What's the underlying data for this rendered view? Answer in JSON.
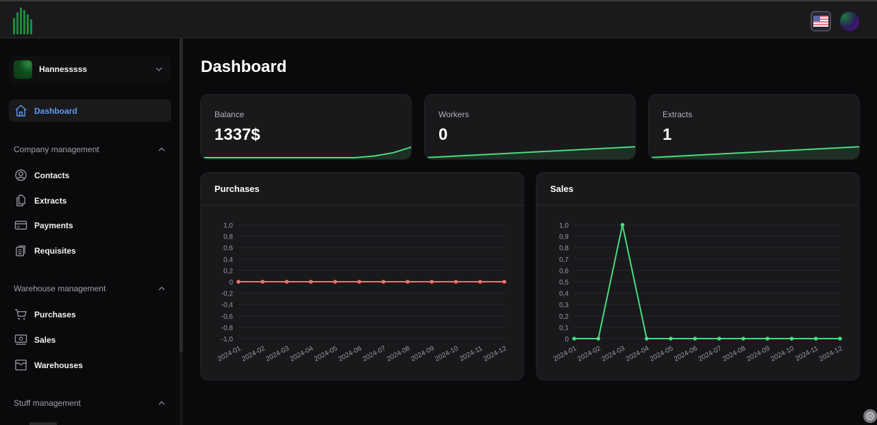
{
  "topbar": {
    "logo_icon": "bar-chart-logo",
    "language_icon": "us-flag-icon",
    "language": "English (US)",
    "user_avatar_icon": "user-avatar"
  },
  "sidebar": {
    "user": {
      "name": "Hannesssss"
    },
    "active_item": {
      "label": "Dashboard",
      "icon": "home-icon"
    },
    "sections": [
      {
        "title": "Company management",
        "expanded": true,
        "items": [
          {
            "label": "Contacts",
            "icon": "user-circle-icon"
          },
          {
            "label": "Extracts",
            "icon": "documents-icon"
          },
          {
            "label": "Payments",
            "icon": "credit-card-icon"
          },
          {
            "label": "Requisites",
            "icon": "clipboard-icon"
          }
        ]
      },
      {
        "title": "Warehouse management",
        "expanded": true,
        "items": [
          {
            "label": "Purchases",
            "icon": "cart-icon"
          },
          {
            "label": "Sales",
            "icon": "cash-icon"
          },
          {
            "label": "Warehouses",
            "icon": "archive-box-icon"
          }
        ]
      },
      {
        "title": "Stuff management",
        "expanded": true,
        "items": []
      }
    ]
  },
  "main": {
    "title": "Dashboard",
    "stats": [
      {
        "label": "Balance",
        "value": "1337$",
        "trend": [
          0,
          0,
          0,
          0,
          0,
          0,
          0,
          0,
          0,
          0.15,
          0.45,
          1
        ]
      },
      {
        "label": "Workers",
        "value": "0",
        "trend": [
          0,
          1
        ]
      },
      {
        "label": "Extracts",
        "value": "1",
        "trend": [
          0,
          1
        ]
      }
    ],
    "accent_green": "#4ade80",
    "accent_red": "#f87171"
  },
  "chart_data": [
    {
      "type": "line",
      "title": "Purchases",
      "categories": [
        "2024-01",
        "2024-02",
        "2024-03",
        "2024-04",
        "2024-05",
        "2024-06",
        "2024-07",
        "2024-08",
        "2024-09",
        "2024-10",
        "2024-11",
        "2024-12"
      ],
      "values": [
        0,
        0,
        0,
        0,
        0,
        0,
        0,
        0,
        0,
        0,
        0,
        0
      ],
      "ylim": [
        -1.0,
        1.0
      ],
      "yticks": [
        "1,0",
        "0,8",
        "0,6",
        "0,4",
        "0,2",
        "0",
        "-0,2",
        "-0,4",
        "-0,6",
        "-0,8",
        "-1,0"
      ],
      "color": "#f87171",
      "grid": true,
      "xlabel": "",
      "ylabel": ""
    },
    {
      "type": "line",
      "title": "Sales",
      "categories": [
        "2024-01",
        "2024-02",
        "2024-03",
        "2024-04",
        "2024-05",
        "2024-06",
        "2024-07",
        "2024-08",
        "2024-09",
        "2024-10",
        "2024-11",
        "2024-12"
      ],
      "values": [
        0,
        0,
        1,
        0,
        0,
        0,
        0,
        0,
        0,
        0,
        0,
        0
      ],
      "ylim": [
        0,
        1.0
      ],
      "yticks": [
        "1,0",
        "0,9",
        "0,8",
        "0,7",
        "0,6",
        "0,5",
        "0,4",
        "0,3",
        "0,2",
        "0,1",
        "0"
      ],
      "color": "#4ade80",
      "grid": true,
      "xlabel": "",
      "ylabel": ""
    }
  ]
}
